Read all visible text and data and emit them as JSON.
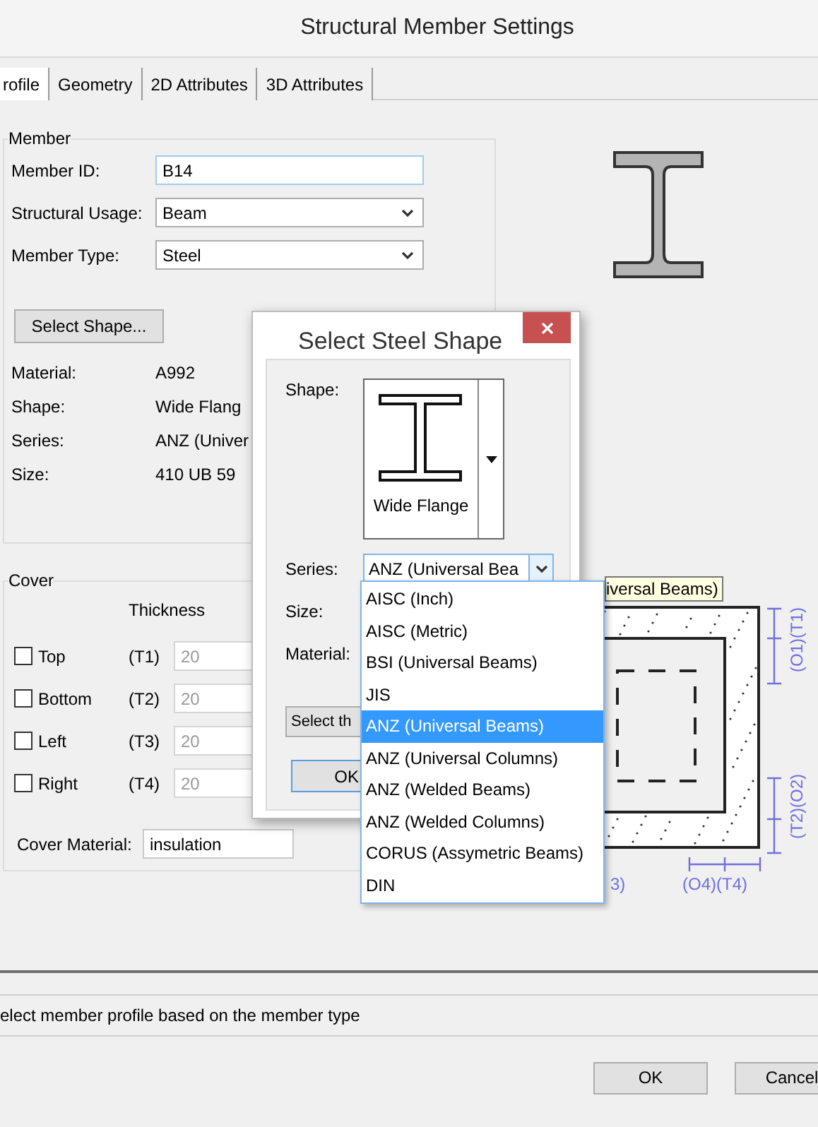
{
  "window": {
    "title": "Structural Member Settings"
  },
  "tabs": [
    {
      "label": "rofile",
      "selected": true
    },
    {
      "label": "Geometry",
      "selected": false
    },
    {
      "label": "2D Attributes",
      "selected": false
    },
    {
      "label": "3D Attributes",
      "selected": false
    }
  ],
  "member": {
    "legend": "Member",
    "fields": [
      {
        "kind": "text",
        "label": "Member ID:",
        "value": "B14"
      },
      {
        "kind": "select",
        "label": "Structural Usage:",
        "value": "Beam"
      },
      {
        "kind": "select",
        "label": "Member Type:",
        "value": "Steel"
      }
    ],
    "select_shape_button": "Select Shape...",
    "properties": [
      {
        "label": "Material:",
        "value": "A992"
      },
      {
        "label": "Shape:",
        "value": "Wide Flang"
      },
      {
        "label": "Series:",
        "value": "ANZ (Univer"
      },
      {
        "label": "Size:",
        "value": "410 UB 59"
      }
    ]
  },
  "cover": {
    "legend": "Cover",
    "thickness_header": "Thickness",
    "sides": [
      {
        "label": "Top",
        "code": "(T1)",
        "value": "20",
        "checked": false,
        "disabled": true
      },
      {
        "label": "Bottom",
        "code": "(T2)",
        "value": "20",
        "checked": false,
        "disabled": true
      },
      {
        "label": "Left",
        "code": "(T3)",
        "value": "20",
        "checked": false,
        "disabled": true
      },
      {
        "label": "Right",
        "code": "(T4)",
        "value": "20",
        "checked": false,
        "disabled": true
      }
    ],
    "material": {
      "label": "Cover Material:",
      "value": "insulation"
    }
  },
  "diagram": {
    "right_top": "(O1)(T1)",
    "right_bottom": "(T2)(O2)",
    "bottom_left": "3)",
    "bottom_right": "(O4)(T4)"
  },
  "status_bar": "elect member profile based on the member type",
  "buttons": [
    "OK",
    "Cancel"
  ],
  "select_dialog": {
    "title": "Select Steel Shape",
    "shape_label": "Shape:",
    "shape_value": "Wide Flange",
    "series_label": "Series:",
    "series_value": "ANZ (Universal Bea",
    "series_expanded": true,
    "series_options": [
      {
        "label": "AISC (Inch)",
        "selected": false
      },
      {
        "label": "AISC (Metric)",
        "selected": false
      },
      {
        "label": "BSI (Universal Beams)",
        "selected": false
      },
      {
        "label": "JIS",
        "selected": false
      },
      {
        "label": "ANZ (Universal Beams)",
        "selected": true
      },
      {
        "label": "ANZ (Universal Columns)",
        "selected": false
      },
      {
        "label": "ANZ (Welded Beams)",
        "selected": false
      },
      {
        "label": "ANZ (Welded Columns)",
        "selected": false
      },
      {
        "label": "CORUS (Assymetric Beams)",
        "selected": false
      },
      {
        "label": "DIN",
        "selected": false
      }
    ],
    "size_label": "Size:",
    "material_label": "Material:",
    "select_button": "Select th",
    "ok_button": "OK"
  },
  "tooltip": "iversal Beams)"
}
